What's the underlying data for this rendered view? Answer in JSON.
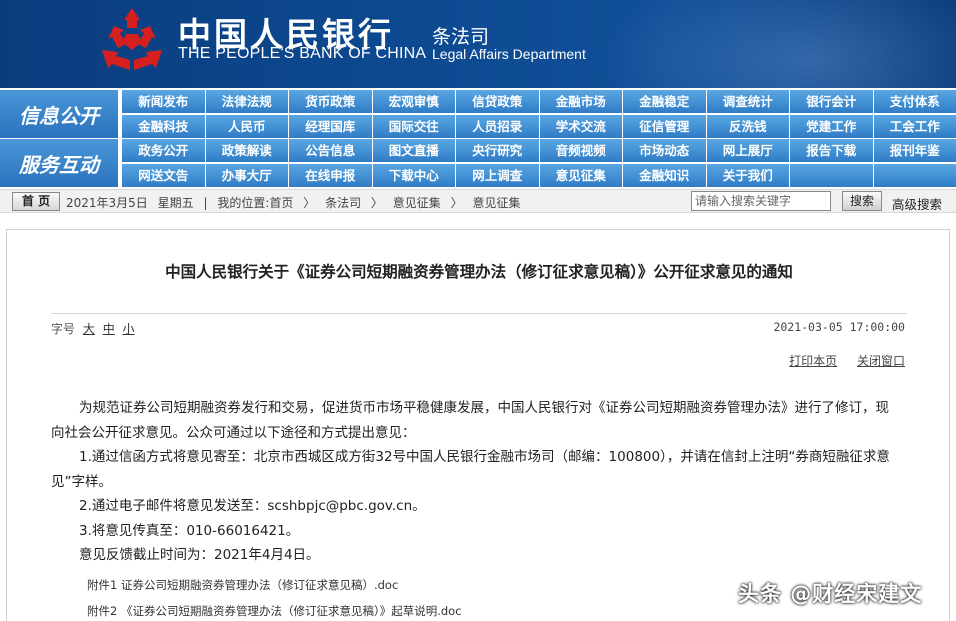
{
  "header": {
    "org_name_cn": "中国人民银行",
    "org_name_en": "THE PEOPLE'S BANK OF CHINA",
    "dept_cn": "条法司",
    "dept_en": "Legal Affairs Department",
    "banner_color": "#0d4a92"
  },
  "nav": {
    "section1_label": "信息公开",
    "section2_label": "服务互动",
    "row1": [
      "新闻发布",
      "法律法规",
      "货币政策",
      "宏观审慎",
      "信贷政策",
      "金融市场",
      "金融稳定",
      "调查统计",
      "银行会计",
      "支付体系"
    ],
    "row2": [
      "金融科技",
      "人民币",
      "经理国库",
      "国际交往",
      "人员招录",
      "学术交流",
      "征信管理",
      "反洗钱",
      "党建工作",
      "工会工作"
    ],
    "row3": [
      "政务公开",
      "政策解读",
      "公告信息",
      "图文直播",
      "央行研究",
      "音频视频",
      "市场动态",
      "网上展厅",
      "报告下载",
      "报刊年鉴"
    ],
    "row4": [
      "网送文告",
      "办事大厅",
      "在线申报",
      "下载中心",
      "网上调查",
      "意见征集",
      "金融知识",
      "关于我们"
    ],
    "accent_color": "#2f7cc6"
  },
  "breadcrumb": {
    "home_label": "首 页",
    "date": "2021年3月5日",
    "weekday": "星期五",
    "location_prefix": "我的位置:首页",
    "sep": "〉",
    "items": [
      "条法司",
      "意见征集",
      "意见征集"
    ],
    "search_placeholder": "请输入搜索关键字",
    "search_button": "搜索",
    "advanced_search": "高级搜索"
  },
  "article": {
    "title": "中国人民银行关于《证券公司短期融资券管理办法（修订征求意见稿）》公开征求意见的通知",
    "fontsize_label": "字号",
    "fontsize_large": "大",
    "fontsize_medium": "中",
    "fontsize_small": "小",
    "datetime": "2021-03-05 17:00:00",
    "print_label": "打印本页",
    "close_label": "关闭窗口",
    "para1": "为规范证券公司短期融资券发行和交易，促进货币市场平稳健康发展，中国人民银行对《证券公司短期融资券管理办法》进行了修订，现向社会公开征求意见。公众可通过以下途径和方式提出意见：",
    "para2": "1.通过信函方式将意见寄至：北京市西城区成方街32号中国人民银行金融市场司（邮编：100800），并请在信封上注明“券商短融征求意见”字样。",
    "para3": "2.通过电子邮件将意见发送至：scshbpjc@pbc.gov.cn。",
    "para4": "3.将意见传真至：010-66016421。",
    "para5": "意见反馈截止时间为：2021年4月4日。",
    "attachment1": "附件1 证券公司短期融资券管理办法（修订征求意见稿）.doc",
    "attachment2": "附件2 《证券公司短期融资券管理办法（修订征求意见稿）》起草说明.doc"
  },
  "watermark": "头条 @财经宋建文"
}
